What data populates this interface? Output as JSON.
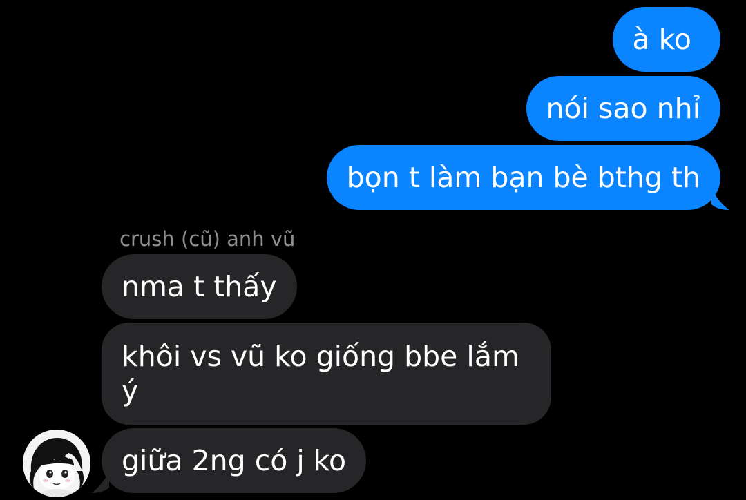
{
  "conversation": {
    "sender_name": "crush (cũ) anh vũ",
    "outgoing": [
      {
        "text": "à ko"
      },
      {
        "text": "nói sao nhỉ"
      },
      {
        "text": "bọn t làm bạn bè bthg th"
      }
    ],
    "incoming": [
      {
        "text": "nma t thấy"
      },
      {
        "text": "khôi vs vũ ko giống bbe lắm ý"
      },
      {
        "text": "giữa 2ng có j ko"
      }
    ],
    "avatar_icon": "anime-girl-avatar-icon"
  },
  "colors": {
    "background": "#000000",
    "outgoing_bubble": "#0a84ff",
    "incoming_bubble": "#262628",
    "sender_label": "#8e8e93",
    "text": "#ffffff"
  }
}
